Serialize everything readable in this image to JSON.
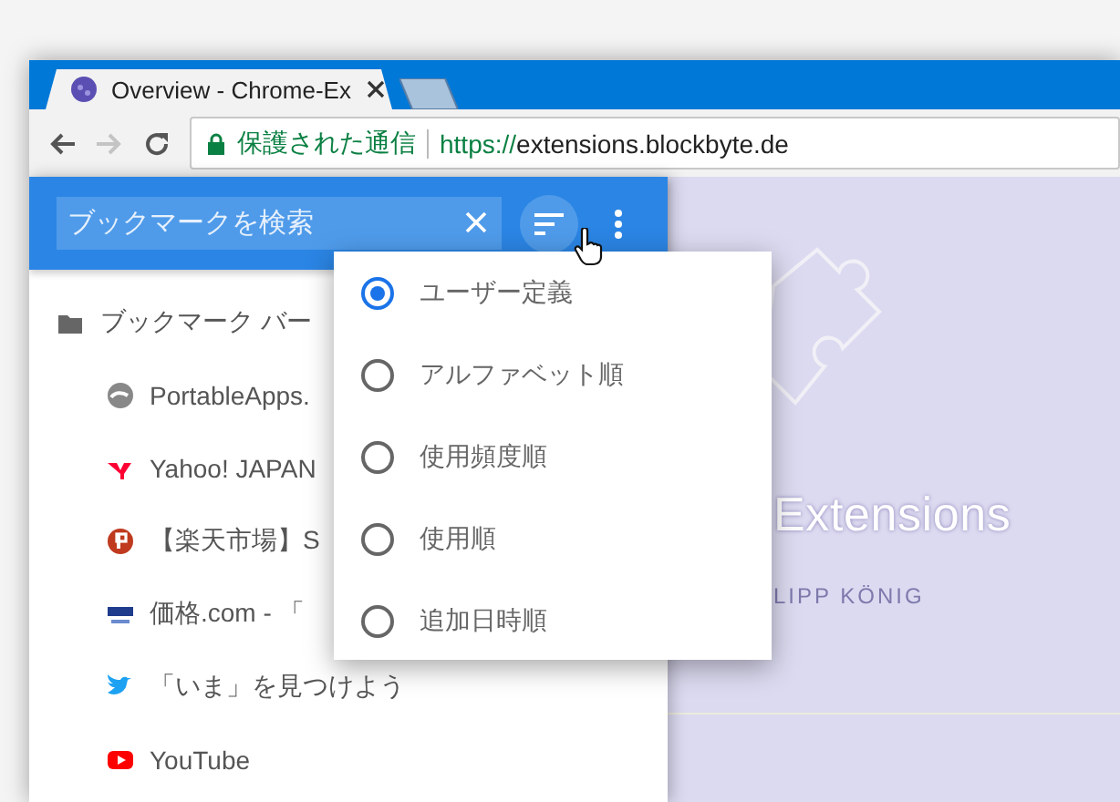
{
  "tab": {
    "title": "Overview - Chrome-Ex",
    "selected": true
  },
  "toolbar": {
    "forward_disabled": true,
    "secure_label": "保護された通信",
    "url_scheme": "https://",
    "url_host": "extensions.blockbyte.de"
  },
  "sidebar": {
    "search": {
      "placeholder": "ブックマークを検索"
    },
    "items": [
      {
        "kind": "folder",
        "label": "ブックマーク バー"
      },
      {
        "kind": "site",
        "label": "PortableApps."
      },
      {
        "kind": "site",
        "label": "Yahoo! JAPAN"
      },
      {
        "kind": "site",
        "label": "【楽天市場】S"
      },
      {
        "kind": "site",
        "label": "価格.com - 「"
      },
      {
        "kind": "site",
        "label": "「いま」を見つけよう"
      },
      {
        "kind": "site",
        "label": "YouTube"
      }
    ]
  },
  "sort_menu": {
    "options": [
      {
        "label": "ユーザー定義",
        "selected": true
      },
      {
        "label": "アルファベット順",
        "selected": false
      },
      {
        "label": "使用頻度順",
        "selected": false
      },
      {
        "label": "使用順",
        "selected": false
      },
      {
        "label": "追加日時順",
        "selected": false
      }
    ]
  },
  "page": {
    "title": "Extensions",
    "author": "LIPP KÖNIG"
  }
}
